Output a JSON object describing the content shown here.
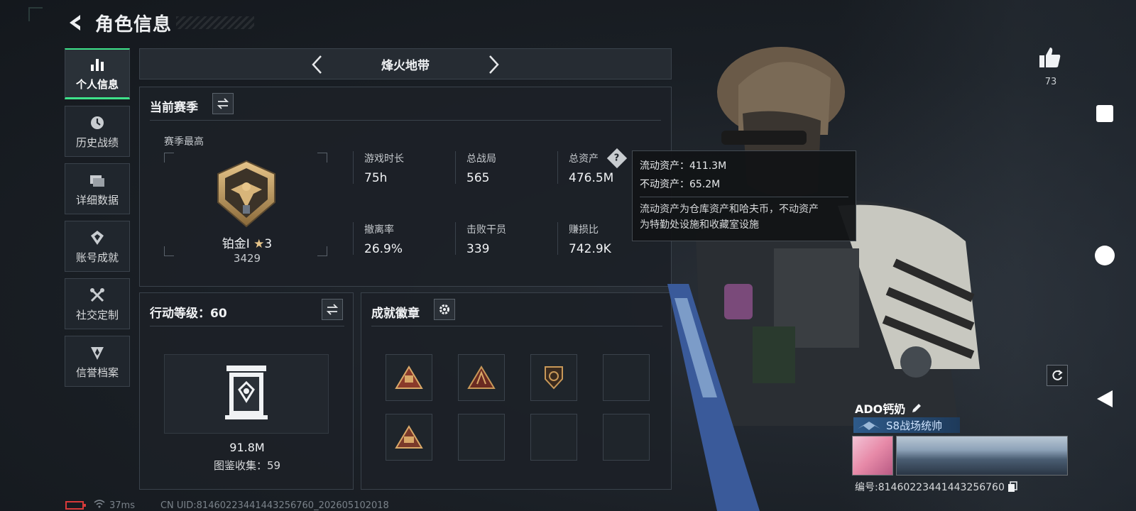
{
  "header": {
    "title": "角色信息"
  },
  "sidebar": {
    "items": [
      {
        "label": "个人信息",
        "icon": "bar-chart-icon",
        "active": true
      },
      {
        "label": "历史战绩",
        "icon": "clock-icon",
        "active": false
      },
      {
        "label": "详细数据",
        "icon": "folder-icon",
        "active": false
      },
      {
        "label": "账号成就",
        "icon": "medal-icon",
        "active": false
      },
      {
        "label": "社交定制",
        "icon": "tools-icon",
        "active": false
      },
      {
        "label": "信誉档案",
        "icon": "shield-icon",
        "active": false
      }
    ]
  },
  "mode": {
    "title": "烽火地带"
  },
  "season": {
    "title": "当前赛季",
    "highest_label": "赛季最高",
    "rank_name": "铂金I",
    "rank_stars": "3",
    "rank_points": "3429",
    "stats": [
      {
        "label": "游戏时长",
        "value": "75h"
      },
      {
        "label": "总战局",
        "value": "565"
      },
      {
        "label": "总资产",
        "value": "476.5M"
      },
      {
        "label": "撤离率",
        "value": "26.9%"
      },
      {
        "label": "击败干员",
        "value": "339"
      },
      {
        "label": "赚损比",
        "value": "742.9K"
      }
    ]
  },
  "tooltip": {
    "liquid": "流动资产：411.3M",
    "fixed": "不动资产：65.2M",
    "desc_line1": "流动资产为仓库资产和哈夫币，不动资产",
    "desc_line2": "为特勤处设施和收藏室设施"
  },
  "action_level": {
    "title": "行动等级：60",
    "value": "91.8M",
    "collection": "图鉴收集：59"
  },
  "achievements": {
    "title": "成就徽章",
    "badges": [
      "badge-1",
      "badge-2",
      "badge-3",
      "",
      "badge-4",
      "",
      "",
      ""
    ]
  },
  "profile": {
    "likes": "73",
    "player_name": "ADO钙奶",
    "rank_title": "S8战场统帅",
    "player_id": "编号:81460223441443256760"
  },
  "status": {
    "ping": "37ms",
    "uid": "CN UID:81460223441443256760_202605102018"
  },
  "colors": {
    "accent": "#3ee28a",
    "panel_bg": "#1c2127",
    "border": "#3a424b"
  }
}
